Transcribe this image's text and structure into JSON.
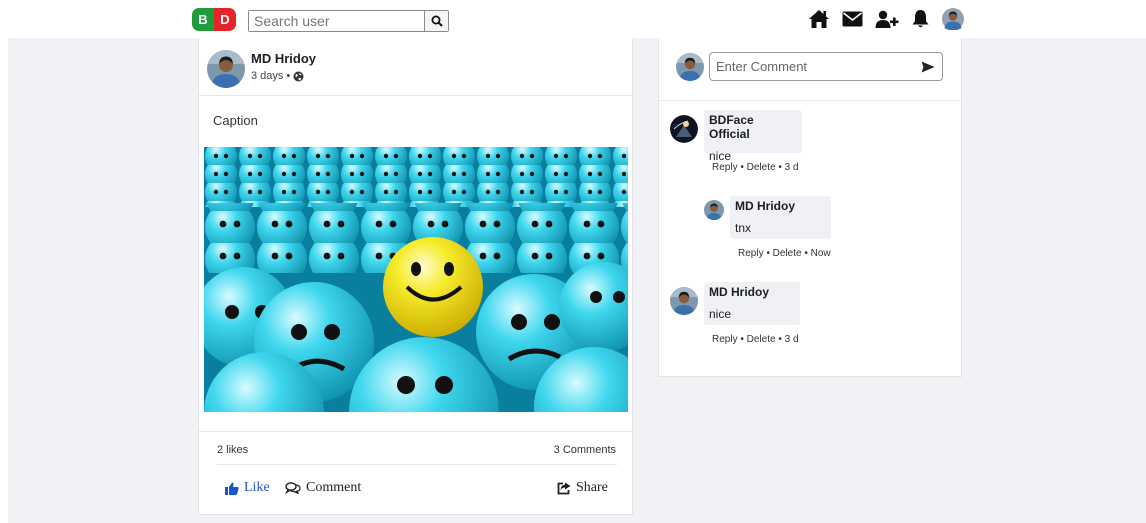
{
  "header": {
    "logo": {
      "left": "B",
      "right": "D",
      "left_color": "#1f9d3a",
      "right_color": "#e3262a"
    },
    "search": {
      "placeholder": "Search user",
      "icon": "search-icon"
    },
    "nav": [
      "home-icon",
      "messages-icon",
      "add-friend-icon",
      "notifications-icon",
      "profile-avatar"
    ]
  },
  "post": {
    "author": "MD Hridoy",
    "time": "3 days",
    "privacy_icon": "globe-icon",
    "caption": "Caption",
    "likes": "2 likes",
    "comments": "3 Comments",
    "actions": {
      "like": "Like",
      "comment": "Comment",
      "share": "Share"
    },
    "like_color": "#1a56c9"
  },
  "comment_box": {
    "placeholder": "Enter Comment",
    "send_icon": "send-icon"
  },
  "comments": [
    {
      "author": "BDFace Official",
      "text": "nice",
      "reply": "Reply",
      "delete": "Delete",
      "time": "3 d"
    },
    {
      "author": "MD Hridoy",
      "text": "tnx",
      "reply": "Reply",
      "delete": "Delete",
      "time": "Now"
    },
    {
      "author": "MD Hridoy",
      "text": "nice",
      "reply": "Reply",
      "delete": "Delete",
      "time": "3 d"
    }
  ]
}
